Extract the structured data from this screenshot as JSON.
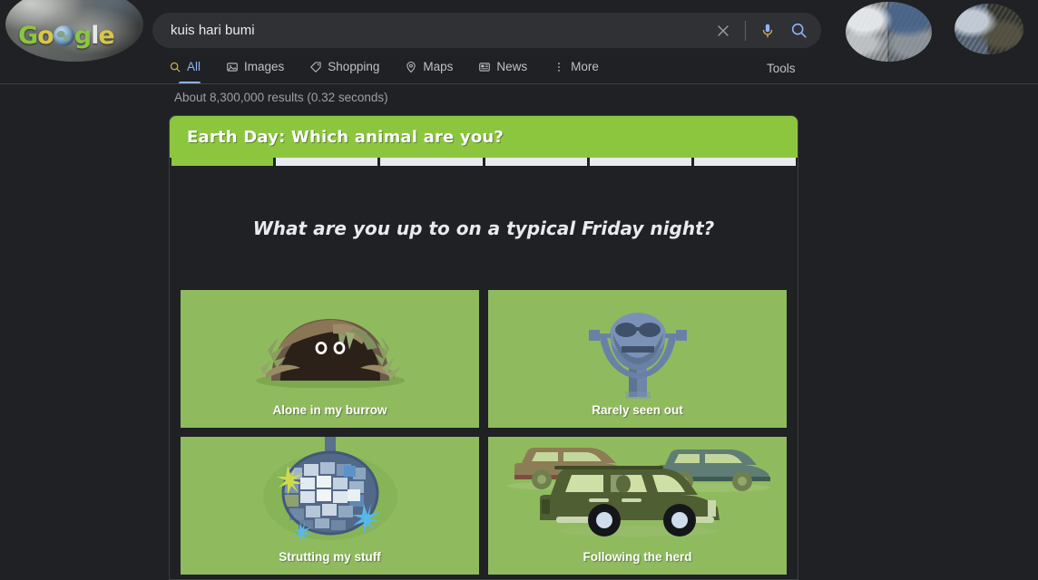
{
  "browser": {
    "logo": {
      "text_parts": [
        "G",
        "o",
        "o",
        "g",
        "l",
        "e"
      ],
      "alt": "google-earth-day-logo"
    }
  },
  "search": {
    "query": "kuis hari bumi",
    "placeholder": "Search",
    "clear_icon": "close-icon",
    "voice_icon": "microphone-icon",
    "submit_icon": "search-icon"
  },
  "nav": {
    "items": [
      {
        "label": "All",
        "icon": "search-icon",
        "active": true
      },
      {
        "label": "Images",
        "icon": "image-icon",
        "active": false
      },
      {
        "label": "Shopping",
        "icon": "tag-icon",
        "active": false
      },
      {
        "label": "Maps",
        "icon": "map-pin-icon",
        "active": false
      },
      {
        "label": "News",
        "icon": "news-icon",
        "active": false
      },
      {
        "label": "More",
        "icon": "more-vertical-icon",
        "active": false
      }
    ],
    "tools_label": "Tools"
  },
  "results": {
    "count_text": "About 8,300,000 results (0.32 seconds)"
  },
  "quiz": {
    "title": "Earth Day: Which animal are you?",
    "header_color": "#8cc63f",
    "progress": {
      "total_steps": 6,
      "current_step": 1,
      "segments": [
        true,
        false,
        false,
        false,
        false,
        false
      ]
    },
    "question": "What are you up to on a typical Friday night?",
    "options": [
      {
        "label": "Alone in my burrow",
        "art": "burrow-with-eyes-illustration"
      },
      {
        "label": "Rarely seen out",
        "art": "coin-viewfinder-face-illustration"
      },
      {
        "label": "Strutting my stuff",
        "art": "disco-ball-illustration"
      },
      {
        "label": "Following the herd",
        "art": "three-station-wagons-illustration"
      }
    ],
    "option_bg_color": "#8fbb5e"
  }
}
